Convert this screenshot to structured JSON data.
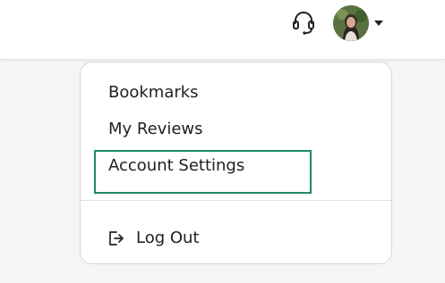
{
  "header": {
    "support_icon": "headset-icon",
    "avatar_icon": "user-avatar",
    "caret_icon": "caret-down-icon"
  },
  "menu": {
    "items": [
      {
        "label": "Bookmarks"
      },
      {
        "label": "My Reviews"
      },
      {
        "label": "Account Settings"
      }
    ],
    "logout": {
      "label": "Log Out",
      "icon": "logout-icon"
    },
    "focus_color": "#1e8c5e"
  }
}
